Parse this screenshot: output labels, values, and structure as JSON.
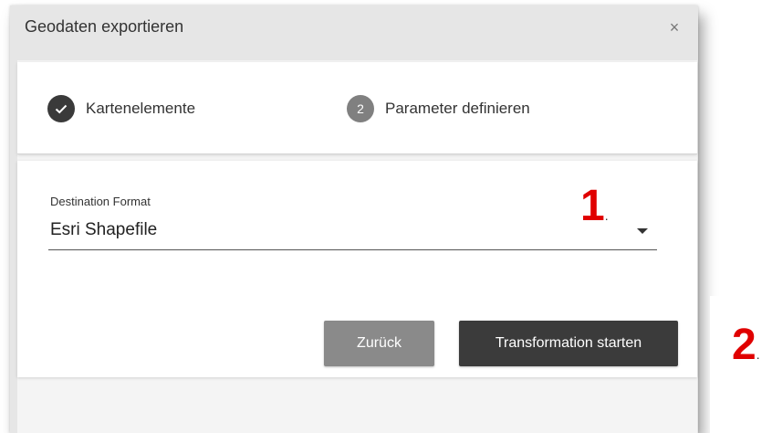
{
  "dialog": {
    "title": "Geodaten exportieren",
    "close_symbol": "×"
  },
  "stepper": {
    "steps": [
      {
        "label": "Kartenelemente",
        "state": "completed",
        "icon": "check-icon"
      },
      {
        "label": "Parameter definieren",
        "number": "2",
        "state": "active"
      }
    ]
  },
  "form": {
    "destination_format": {
      "label": "Destination Format",
      "value": "Esri Shapefile"
    }
  },
  "buttons": {
    "back_label": "Zurück",
    "start_label": "Transformation starten"
  },
  "annotations": {
    "marker1": "1",
    "marker2": "2",
    "dot": ".",
    "color": "#e00000"
  },
  "colors": {
    "title_bar": "#e6e6e6",
    "step_done": "#3a3a3a",
    "step_number": "#808080",
    "button_back": "#8a8a8a",
    "button_start": "#3b3b3b"
  }
}
